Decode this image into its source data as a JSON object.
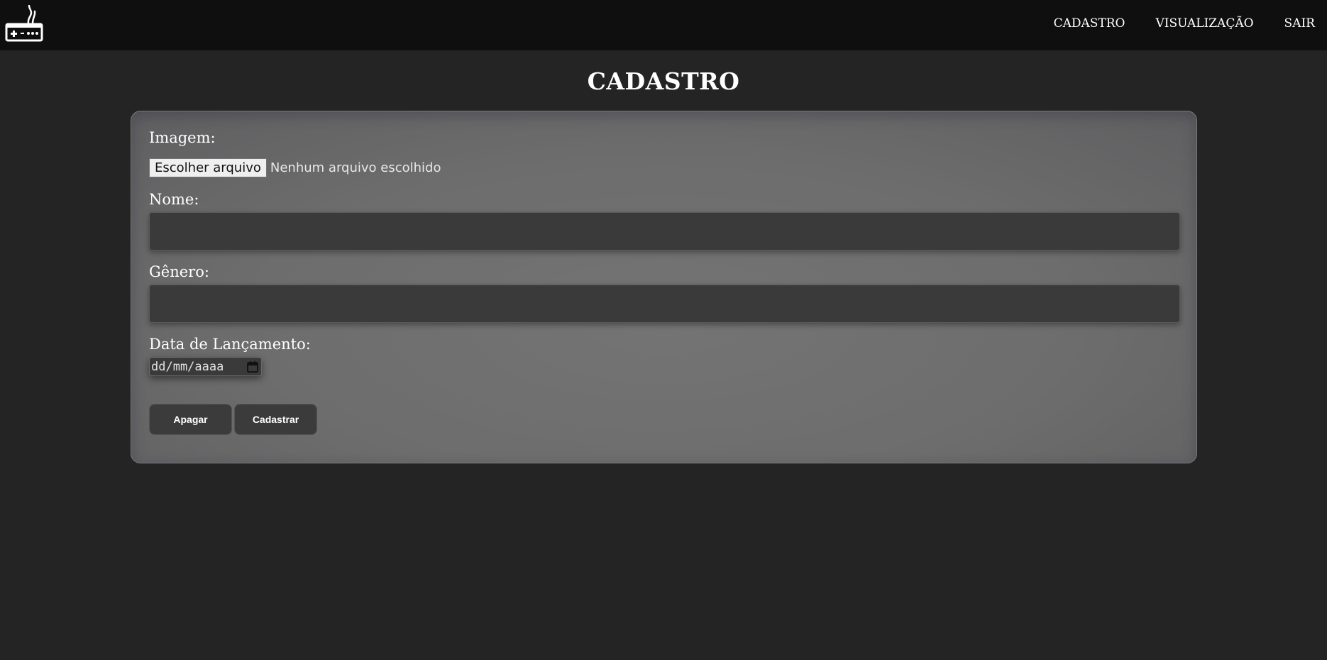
{
  "header": {
    "logo_icon": "game-controller-icon",
    "nav": [
      {
        "label": "CADASTRO"
      },
      {
        "label": "VISUALIZAÇÃO"
      },
      {
        "label": "SAIR"
      }
    ]
  },
  "page": {
    "title": "CADASTRO"
  },
  "form": {
    "image_label": "Imagem:",
    "file_button": "Escolher arquivo",
    "file_status": "Nenhum arquivo escolhido",
    "name_label": "Nome:",
    "name_value": "",
    "genre_label": "Gênero:",
    "genre_value": "",
    "release_label": "Data de Lançamento:",
    "release_placeholder": "dd/mm/aaaa",
    "calendar_icon": "calendar-icon",
    "clear_button": "Apagar",
    "submit_button": "Cadastrar"
  },
  "colors": {
    "header_bg": "#0f0f0f",
    "page_bg": "#242424",
    "card_bg": "#6f6f6f",
    "input_bg": "#3a3a3a"
  }
}
